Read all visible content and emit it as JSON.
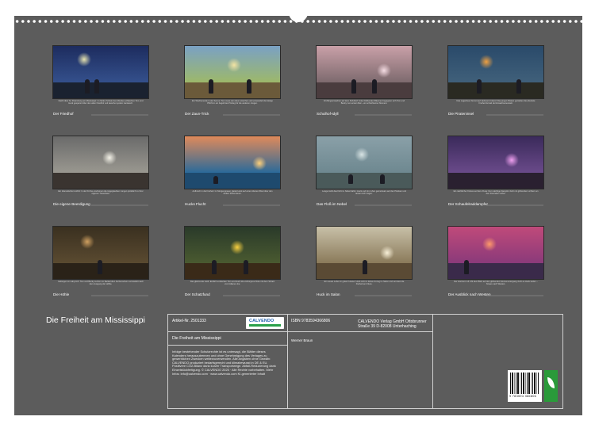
{
  "calendar_title": "Die Freiheit am Mississippi",
  "cells": [
    {
      "title": "Der Friedhof",
      "desc": "Nacht über St. Petersburg am Mississippi: Im fahlen Schein des Mondes schleichen Tom und Huck gespannt über den alten Friedhof und lauschen jedem Geräusch.",
      "colors": {
        "sky": "#1d2c5e",
        "mid": "#34508c",
        "ground": "#1a2230",
        "glow": "#e8e4b0"
      }
    },
    {
      "title": "Der Zaun-Trick",
      "desc": "Ein Wochenende in der Sonne: Tom muss den Zaun streichen und verwandelt die lästige Pflicht in ein begehrtes Privileg für die anderen Jungen.",
      "colors": {
        "sky": "#7aa1c4",
        "mid": "#9db86a",
        "ground": "#6b5a3a",
        "glow": "#f3e3a3"
      }
    },
    {
      "title": "Schulhof-Idyll",
      "desc": "Frühlingserwachen auf dem Schulhof: Unter blühenden Bäumen begegnen sich Tom und Becky zum ersten Mal – ein schüchterner Moment.",
      "colors": {
        "sky": "#c9a0a8",
        "mid": "#7d6a6e",
        "ground": "#4a3c3e",
        "glow": "#f6dde4"
      }
    },
    {
      "title": "Die Pirateninsel",
      "desc": "Das Lagerfeuer brennt auf Jackson's Island: Die jungen Piraten genießen die absolute Freiheit fernab der Erwachsenenwelt.",
      "colors": {
        "sky": "#2a4a6a",
        "mid": "#40607a",
        "ground": "#2a2a22",
        "glow": "#f0a040"
      }
    },
    {
      "title": "Die eigene Beerdigung",
      "desc": "Ein dramatischer Auftritt: In der Kirche erscheinen die totgeglaubten Jungen pünktlich zu ihrer eigenen Trauerfeier.",
      "colors": {
        "sky": "#6a6a6a",
        "mid": "#9a9890",
        "ground": "#3a3430",
        "glow": "#f4f2e8"
      }
    },
    {
      "title": "Hucks Flucht",
      "desc": "Aufbruch in die Freiheit: Im Morgengrauen gleitet Huck auf einem kleinen Boot über den weiten Fluss davon.",
      "colors": {
        "sky": "#e08a5a",
        "mid": "#2a6a9a",
        "ground": "#1e4a6e",
        "glow": "#ffd07a"
      }
    },
    {
      "title": "Das Floß im Nebel",
      "desc": "Lange treibt das Floß im Nebel dahin: Huck und Jim ruhen gemeinsam auf den Planken und lassen sich tragen.",
      "colors": {
        "sky": "#8aa0a8",
        "mid": "#6e8890",
        "ground": "#4a5a5a",
        "glow": "#d8e4e4"
      }
    },
    {
      "title": "Der Schaufelraddampfer",
      "desc": "Ein nächtlicher Koloss auf dem Fluss: Der mächtige Dampfer zieht mit glühenden Lichtern an den Freunden vorbei.",
      "colors": {
        "sky": "#3a2a5a",
        "mid": "#6a4a8a",
        "ground": "#2a2030",
        "glow": "#f0a0f0"
      }
    },
    {
      "title": "Die Höhle",
      "desc": "Gefangen im Labyrinth: Tom und Becky suchen im flackernden Kerzenschein verzweifelt nach dem Ausgang der Höhle.",
      "colors": {
        "sky": "#3a3020",
        "mid": "#5a4a30",
        "ground": "#2a2218",
        "glow": "#d0a060"
      }
    },
    {
      "title": "Der Schatzfund",
      "desc": "Das glänzende Gold: Endlich entdecken Tom und Huck die verborgene Kiste mit dem Schatz von Indianer-Joe.",
      "colors": {
        "sky": "#2a3a2a",
        "mid": "#4a5a30",
        "ground": "#3a2a18",
        "glow": "#f8d040"
      }
    },
    {
      "title": "Huck im Salon",
      "desc": "Ein neues Leben in gutem Hause: Huck sitzt im feinen Anzug im Salon und vermisst die Freiheit am Fluss.",
      "colors": {
        "sky": "#c8c0a8",
        "mid": "#8a7a5a",
        "ground": "#5a4a34",
        "glow": "#f8f0d8"
      }
    },
    {
      "title": "Der Ausblick nach Westen",
      "desc": "Der Horizont ruft: Mit dem Blick auf den glühenden Sonnenuntergang zieht es Huck weiter – hinaus nach Westen.",
      "colors": {
        "sky": "#c04a7a",
        "mid": "#8a3a7a",
        "ground": "#3a2a4a",
        "glow": "#ff9a6a"
      }
    }
  ],
  "info": {
    "artnr": "Artikel-Nr. 2501333",
    "logo": "CALVENDO",
    "title": "Die Freiheit am Mississippi",
    "legal": "Infolge bestehender Schutzrechte ist es untersagt, die Blätter dieses Kalenders herauszutrennen und ohne Genehmigung des Verlages zu gewerblichen Zwecken weiterzuverwenden. Alle Angaben ohne Gewähr. CALVENDO produziert bedarfsgerecht und klimabewusst in DE & EU. Positivere CO2-Bilanz dank kurzer Transportwege. Abfall-Reduzierung dank Einzelstückfertigung. © CALVENDO 2025 · Alle Rechte vorbehalten. Mehr Infos: info@calvendo.com · www.calvendo.com KI-generierter Inhalt",
    "isbn": "ISBN 9783594366806",
    "author": "Werner Braun",
    "publisher": "CALVENDO Verlag GmbH Ottobrunner Straße 39 D-82008 Unterhaching",
    "barcode_digits": "9 783594 366806"
  }
}
